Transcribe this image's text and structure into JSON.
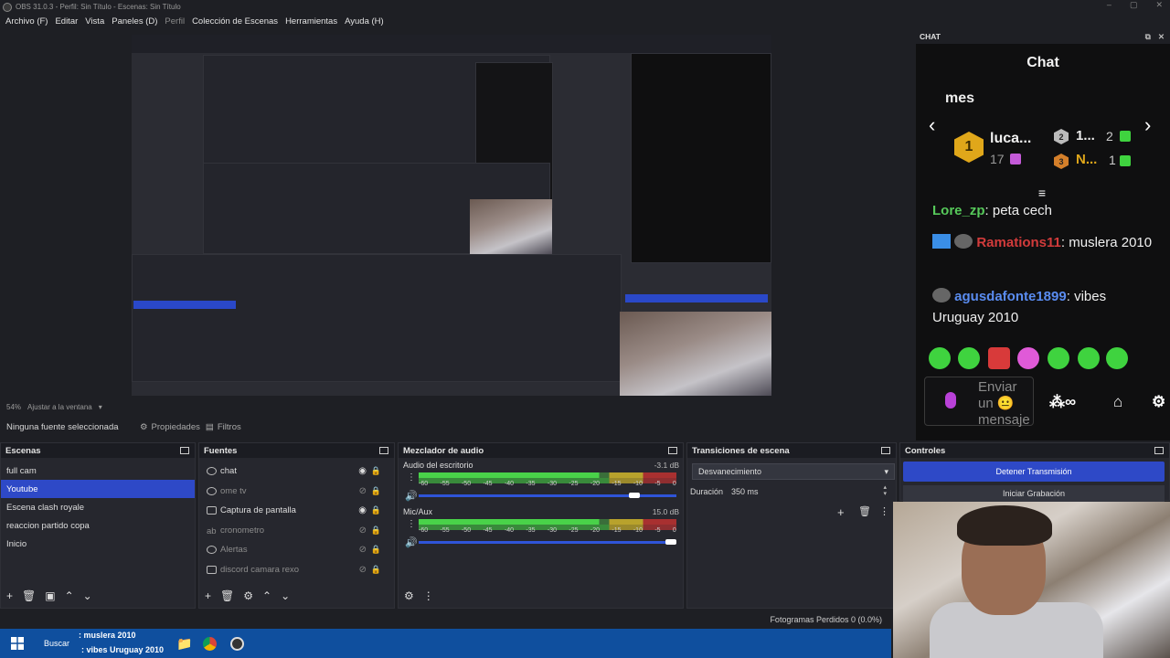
{
  "window": {
    "title": "OBS 31.0.3 - Perfil: Sin Título - Escenas: Sin Título",
    "min": "–",
    "max": "▢",
    "close": "✕"
  },
  "menu": [
    {
      "label": "Archivo (F)",
      "enabled": true
    },
    {
      "label": "Editar",
      "enabled": true
    },
    {
      "label": "Vista",
      "enabled": true
    },
    {
      "label": "Paneles (D)",
      "enabled": true
    },
    {
      "label": "Perfil",
      "enabled": false
    },
    {
      "label": "Colección de Escenas",
      "enabled": true
    },
    {
      "label": "Herramientas",
      "enabled": true
    },
    {
      "label": "Ayuda (H)",
      "enabled": true
    }
  ],
  "preview": {
    "zoom": "54%",
    "fit_label": "Ajustar a la ventana"
  },
  "source_bar": {
    "no_selection": "Ninguna fuente seleccionada",
    "properties": "Propiedades",
    "filters": "Filtros"
  },
  "chat": {
    "dock_title": "CHAT",
    "title": "Chat",
    "header_partial": "mes",
    "top_gifter": {
      "rank": "1",
      "name": "luca...",
      "count": "17"
    },
    "second": {
      "rank": "2",
      "name": "1...",
      "count": "2"
    },
    "third": {
      "rank": "3",
      "name": "N...",
      "count": "1"
    },
    "messages": [
      {
        "user": "Lore_zp",
        "sep": ": ",
        "text": "peta cech"
      },
      {
        "user": "Ramations11",
        "sep": ": ",
        "text": "muslera 2010"
      },
      {
        "user": "agusdafonte1899",
        "sep": ": ",
        "text": "vibes Uruguay 2010"
      }
    ],
    "send_placeholder": "Enviar un 😐 mensaje",
    "colors": {
      "green": "#56c95a",
      "red": "#d23b3b",
      "blue": "#5a8cf0",
      "gold": "#e0a71a"
    }
  },
  "scenes": {
    "title": "Escenas",
    "items": [
      {
        "label": "full cam",
        "selected": false
      },
      {
        "label": "Youtube",
        "selected": true
      },
      {
        "label": "Escena clash royale",
        "selected": false
      },
      {
        "label": "reaccion partido copa",
        "selected": false
      },
      {
        "label": "Inicio",
        "selected": false
      }
    ]
  },
  "sources": {
    "title": "Fuentes",
    "items": [
      {
        "label": "chat",
        "visible": true
      },
      {
        "label": "ome tv",
        "visible": false
      },
      {
        "label": "Captura de pantalla",
        "visible": true
      },
      {
        "label": "cronometro",
        "visible": false
      },
      {
        "label": "Alertas",
        "visible": false
      },
      {
        "label": "discord camara rexo",
        "visible": false
      }
    ]
  },
  "mixer": {
    "title": "Mezclador de audio",
    "channels": [
      {
        "name": "Audio del escritorio",
        "db": "-3.1 dB",
        "level": 0.85
      },
      {
        "name": "Mic/Aux",
        "db": "15.0 dB",
        "level": 1.0
      }
    ],
    "ticks": [
      "-60",
      "-55",
      "-50",
      "-45",
      "-40",
      "-35",
      "-30",
      "-25",
      "-20",
      "-15",
      "-10",
      "-5",
      "0"
    ]
  },
  "transitions": {
    "title": "Transiciones de escena",
    "selected": "Desvanecimiento",
    "duration_label": "Duración",
    "duration_value": "350 ms"
  },
  "controls": {
    "title": "Controles",
    "stop_stream": "Detener Transmisión",
    "start_record": "Iniciar Grabación"
  },
  "status": {
    "dropped_frames": "Fotogramas Perdidos 0 (0.0%)"
  },
  "taskbar": {
    "search": "Buscar",
    "overlay_line1": ": muslera 2010",
    "overlay_line2": ": vibes Uruguay 2010"
  }
}
